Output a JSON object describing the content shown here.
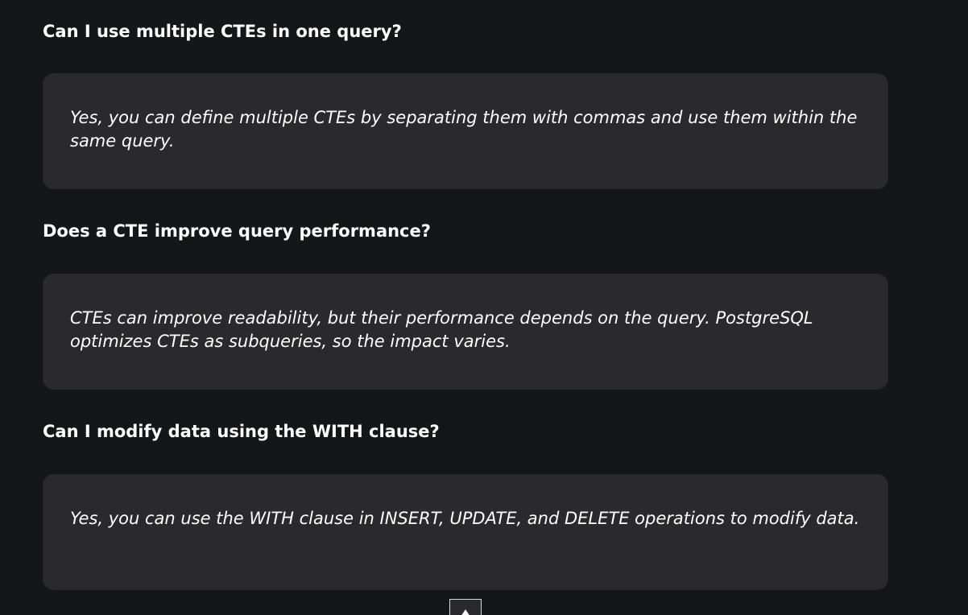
{
  "faq": [
    {
      "question": "Can I use multiple CTEs in one query?",
      "answer": "Yes, you can define multiple CTEs by separating them with commas and use them within the same query."
    },
    {
      "question": "Does a CTE improve query performance?",
      "answer": "CTEs can improve readability, but their performance depends on the query. PostgreSQL optimizes CTEs as subqueries, so the impact varies."
    },
    {
      "question": "Can I modify data using the WITH clause?",
      "answer": "Yes, you can use the WITH clause in INSERT, UPDATE, and DELETE operations to modify data."
    }
  ],
  "scroll_top": {
    "icon": "arrow-up-icon"
  },
  "colors": {
    "background": "#151619",
    "card": "#2a2a2e",
    "text": "#ffffff"
  }
}
